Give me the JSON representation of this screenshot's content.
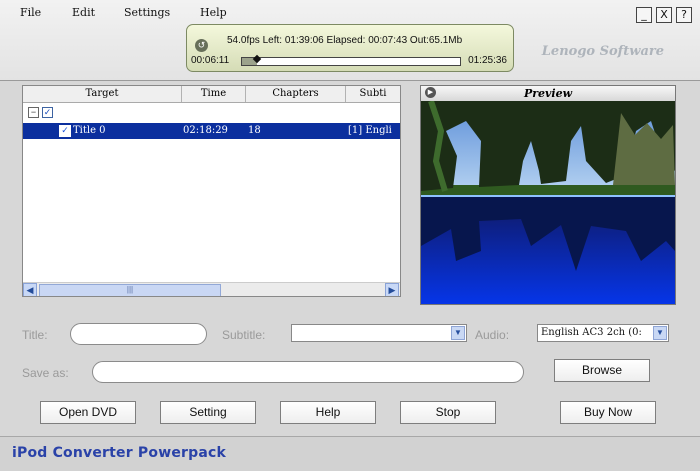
{
  "menu": [
    "File",
    "Edit",
    "Settings",
    "Help"
  ],
  "window_controls": [
    "_",
    "X",
    "?"
  ],
  "brand": "Lenogo Software",
  "status": {
    "line": "54.0fps Left: 01:39:06 Elapsed: 00:07:43 Out:65.1Mb",
    "current_time": "00:06:11",
    "total_time": "01:25:36",
    "progress_fraction": 0.07
  },
  "table": {
    "columns": [
      "Target",
      "Time",
      "Chapters",
      "Subti"
    ],
    "root_checked": true,
    "rows": [
      {
        "target": "Title 0",
        "time": "02:18:29",
        "chapters": "18",
        "subtitle": "[1] Engli",
        "checked": true
      }
    ]
  },
  "preview": {
    "title": "Preview"
  },
  "form": {
    "title_label": "Title:",
    "title_value": "",
    "subtitle_label": "Subtitle:",
    "subtitle_value": "",
    "audio_label": "Audio:",
    "audio_value": "English AC3 2ch (0:",
    "save_as_label": "Save as:",
    "save_as_value": ""
  },
  "buttons": {
    "browse": "Browse",
    "open_dvd": "Open DVD",
    "setting": "Setting",
    "help": "Help",
    "stop": "Stop",
    "buy_now": "Buy Now"
  },
  "footer": {
    "title": "iPod Converter Powerpack"
  },
  "colors": {
    "selection": "#0b2f9e",
    "panel": "#d7d7d7",
    "status_bg": "#e9efcc",
    "footer_text": "#2a42a8"
  }
}
